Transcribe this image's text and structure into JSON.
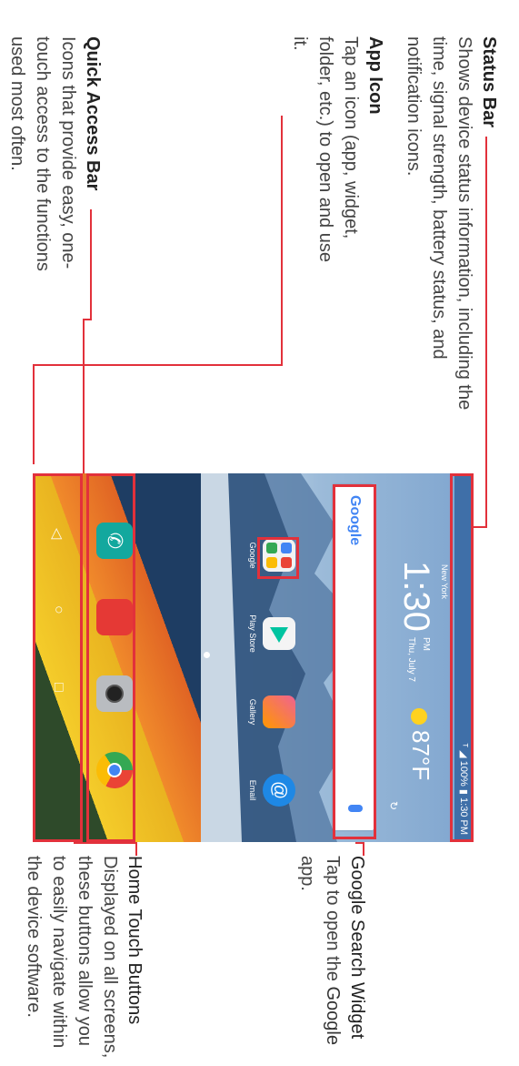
{
  "callouts": {
    "status_bar": {
      "title": "Status Bar",
      "description": "Shows device status information, including the time, signal strength, battery status, and notification icons."
    },
    "app_icon": {
      "title": "App Icon",
      "description": "Tap an icon (app, widget, folder, etc.) to open and use it."
    },
    "quick_access_bar": {
      "title": "Quick Access Bar",
      "description": "Icons that provide easy, one-touch access to the functions used most often."
    },
    "google_search_widget": {
      "title": "Google Search Widget",
      "description_before": "Tap to open the ",
      "description_em": "Google",
      "description_after": " app."
    },
    "home_touch_buttons": {
      "title": "Home Touch Buttons",
      "description": "Displayed on all screens, these buttons allow you to easily navigate within the device software."
    }
  },
  "screen": {
    "status": {
      "carrier_icon": "carrier-icon",
      "signal_icon": "signal-icon",
      "battery": "100%",
      "time": "1:30 PM"
    },
    "weather": {
      "city": "New York",
      "time": "1:30",
      "ampm": "PM",
      "date": "Thu, July 7",
      "temperature": "87°F",
      "icon": "sun-icon"
    },
    "search": {
      "logo": "Google",
      "mic_icon": "mic-icon"
    },
    "apps": [
      {
        "label": "Google",
        "icon": "google-folder-icon"
      },
      {
        "label": "Play Store",
        "icon": "play-store-icon"
      },
      {
        "label": "Gallery",
        "icon": "gallery-icon"
      },
      {
        "label": "Email",
        "icon": "email-icon"
      }
    ],
    "quick_access": [
      {
        "name": "Phone",
        "icon": "phone-icon"
      },
      {
        "name": "Messaging",
        "icon": "messaging-icon"
      },
      {
        "name": "Camera",
        "icon": "camera-icon"
      },
      {
        "name": "Chrome",
        "icon": "chrome-icon"
      }
    ],
    "nav_buttons": [
      {
        "name": "Back",
        "icon": "back-icon"
      },
      {
        "name": "Home",
        "icon": "home-icon"
      },
      {
        "name": "Recent Apps",
        "icon": "recents-icon"
      }
    ]
  },
  "colors": {
    "callout_red": "#e2313b",
    "status_bar_blue": "#3f6fa8"
  }
}
